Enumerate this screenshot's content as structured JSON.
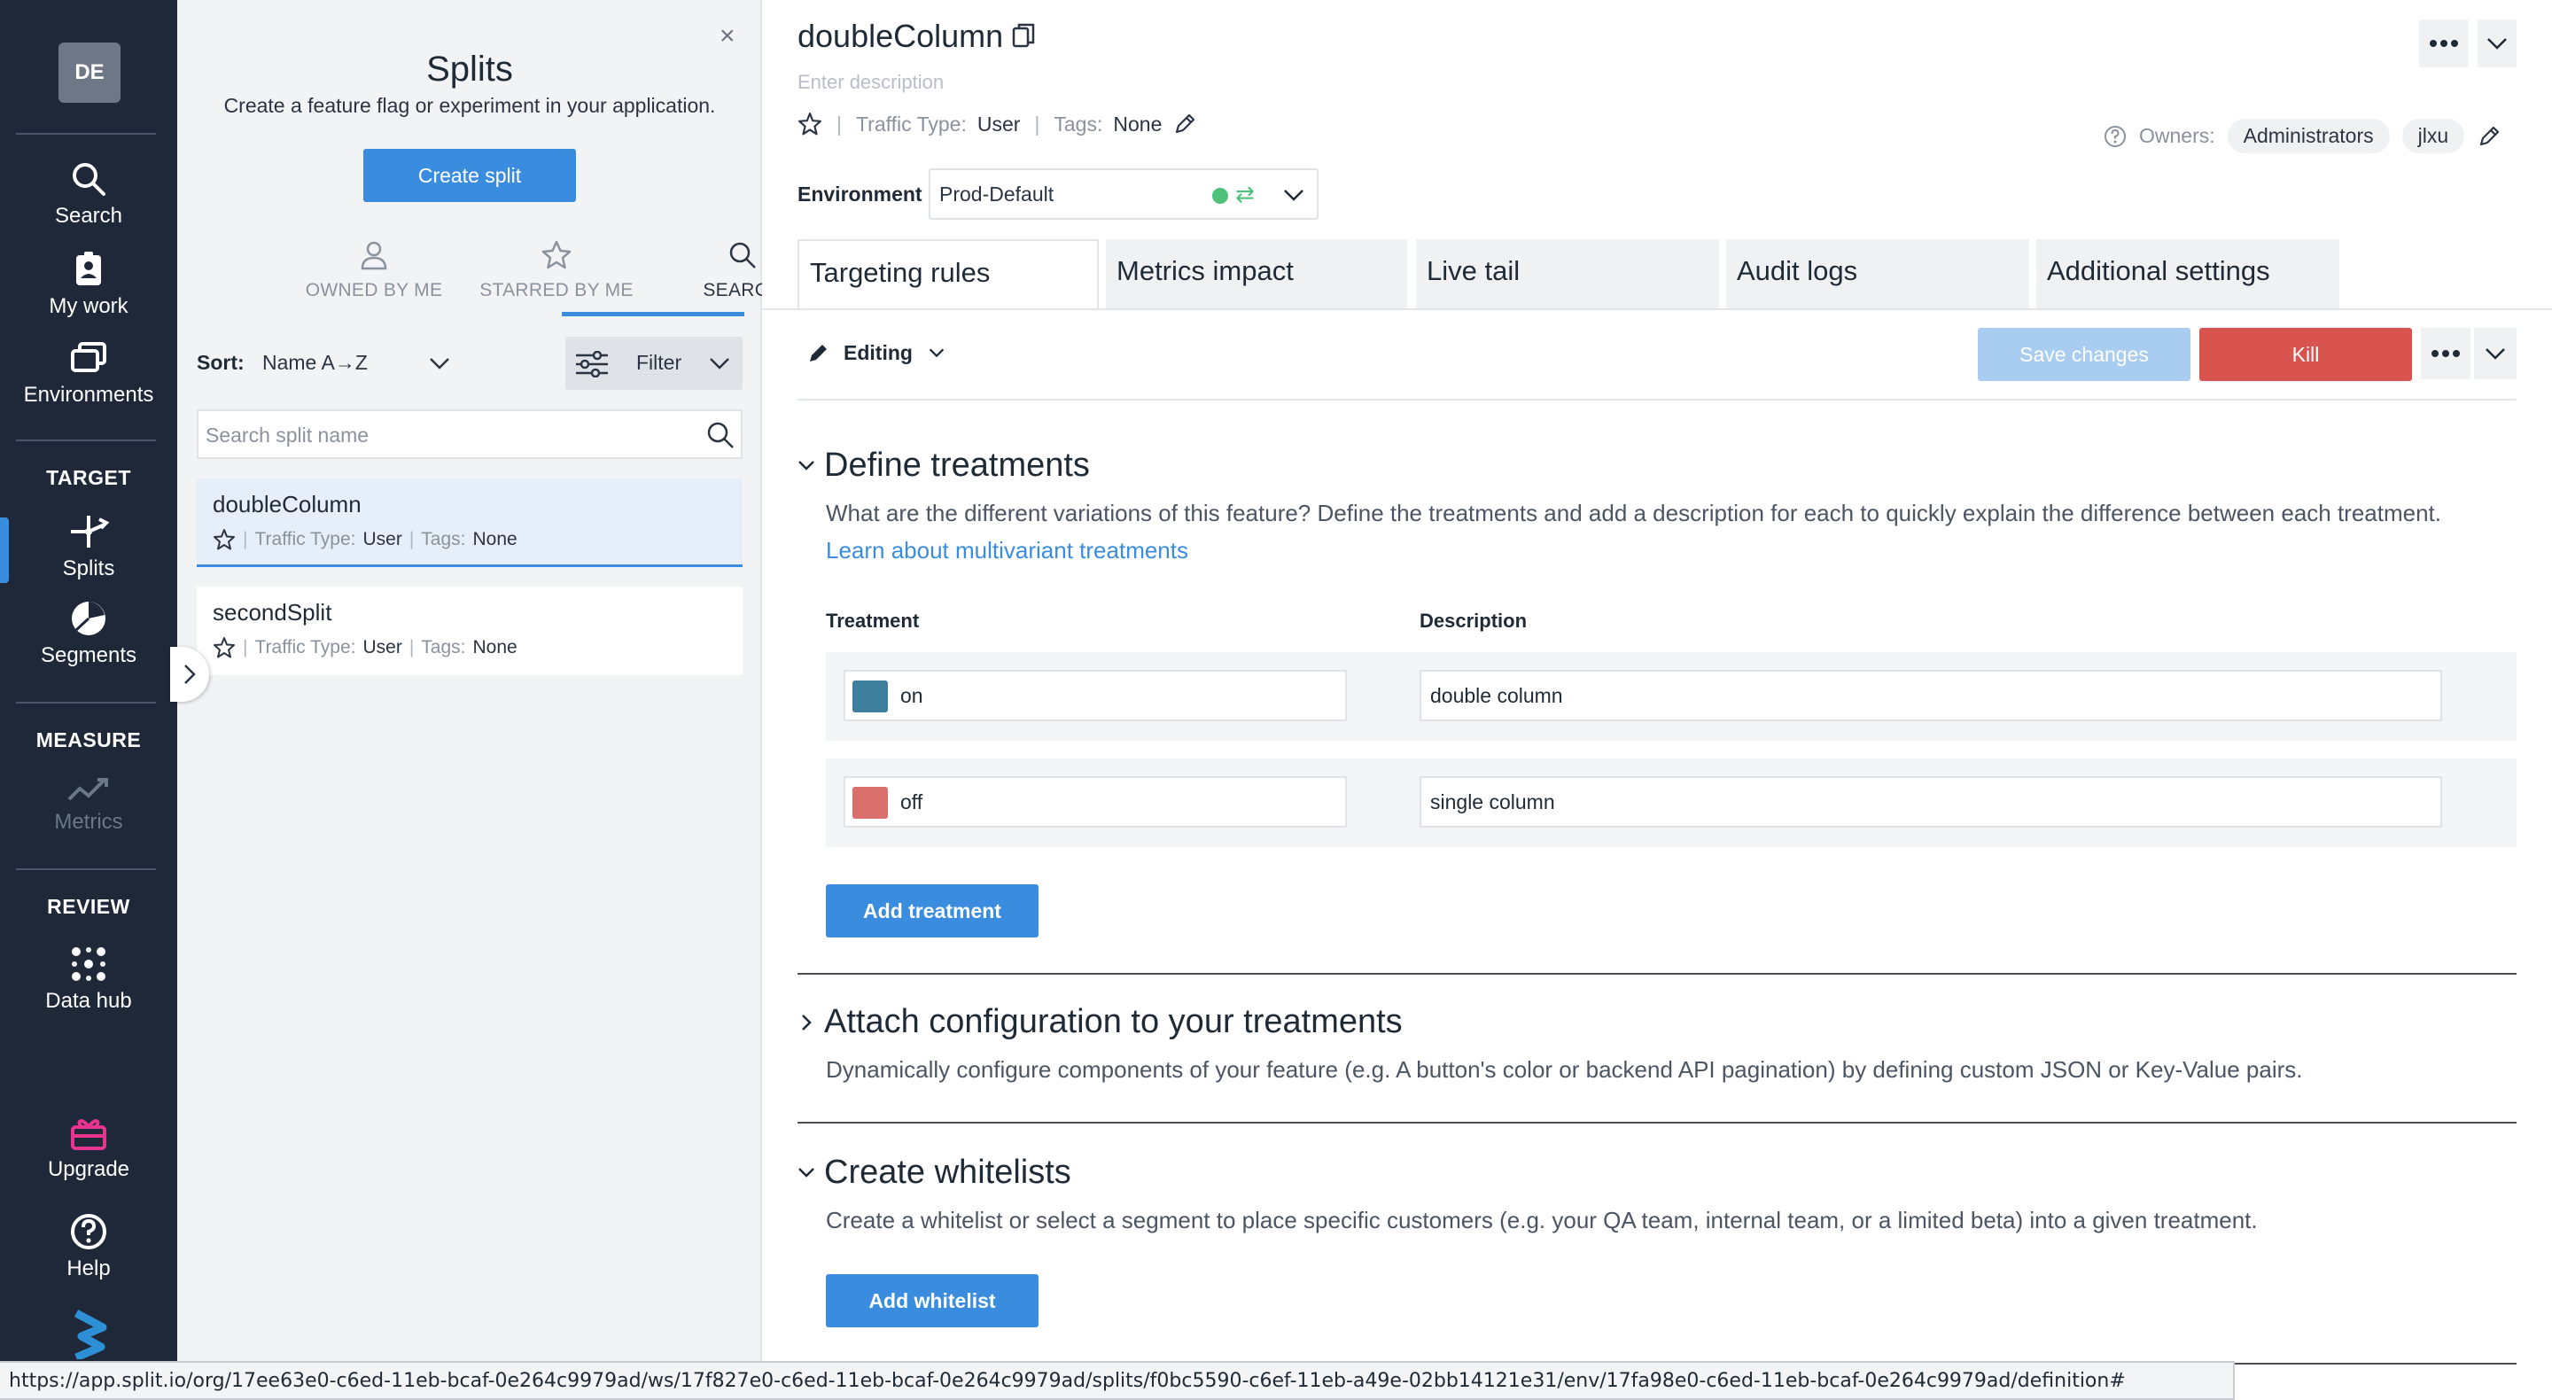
{
  "nav": {
    "avatar": "DE",
    "items": {
      "search": "Search",
      "my_work": "My work",
      "environments": "Environments",
      "splits": "Splits",
      "segments": "Segments",
      "metrics": "Metrics",
      "data_hub": "Data hub",
      "upgrade": "Upgrade",
      "help": "Help"
    },
    "sections": {
      "target": "TARGET",
      "measure": "MEASURE",
      "review": "REVIEW"
    },
    "active": "splits"
  },
  "panel": {
    "title": "Splits",
    "subtitle": "Create a feature flag or experiment in your application.",
    "create_button": "Create split",
    "tabs": [
      "OWNED BY ME",
      "STARRED BY ME",
      "SEARCH"
    ],
    "active_tab": "SEARCH",
    "sort_label": "Sort:",
    "sort_value": "Name A→Z",
    "filter_label": "Filter",
    "search_placeholder": "Search split name",
    "splits": [
      {
        "name": "doubleColumn",
        "traffic_label": "Traffic Type:",
        "traffic_type": "User",
        "tags_label": "Tags:",
        "tags": "None",
        "selected": true
      },
      {
        "name": "secondSplit",
        "traffic_label": "Traffic Type:",
        "traffic_type": "User",
        "tags_label": "Tags:",
        "tags": "None",
        "selected": false
      }
    ]
  },
  "main": {
    "title": "doubleColumn",
    "description_placeholder": "Enter description",
    "traffic_label": "Traffic Type:",
    "traffic_type": "User",
    "tags_label": "Tags:",
    "tags": "None",
    "owners_label": "Owners:",
    "owners": [
      "Administrators",
      "jlxu"
    ],
    "environment_label": "Environment",
    "environment_value": "Prod-Default",
    "tabs": [
      "Targeting rules",
      "Metrics impact",
      "Live tail",
      "Audit logs",
      "Additional settings"
    ],
    "active_tab": "Targeting rules",
    "edit_mode": "Editing",
    "save_button": "Save changes",
    "kill_button": "Kill",
    "define": {
      "title": "Define treatments",
      "description": "What are the different variations of this feature? Define the treatments and add a description for each to quickly explain the difference between each treatment.",
      "link": "Learn about multivariant treatments",
      "col_treatment": "Treatment",
      "col_description": "Description",
      "treatments": [
        {
          "name": "on",
          "description": "double column",
          "color": "#3d7f9d"
        },
        {
          "name": "off",
          "description": "single column",
          "color": "#d9706b"
        }
      ],
      "add_button": "Add treatment"
    },
    "attach": {
      "title": "Attach configuration to your treatments",
      "description": "Dynamically configure components of your feature (e.g. A button's color or backend API pagination) by defining custom JSON or Key-Value pairs."
    },
    "whitelist": {
      "title": "Create whitelists",
      "description": "Create a whitelist or select a segment to place specific customers (e.g. your QA team, internal team, or a limited beta) into a given treatment.",
      "add_button": "Add whitelist"
    }
  },
  "status_url": "https://app.split.io/org/17ee63e0-c6ed-11eb-bcaf-0e264c9979ad/ws/17f827e0-c6ed-11eb-bcaf-0e264c9979ad/splits/f0bc5590-c6ef-11eb-a49e-02bb14121e31/env/17fa98e0-c6ed-11eb-bcaf-0e264c9979ad/definition#",
  "colors": {
    "nav_bg": "#1e2838",
    "accent": "#3a8dde",
    "kill": "#d9534f",
    "save_disabled": "#a9cdf0",
    "upgrade": "#e8338f"
  }
}
